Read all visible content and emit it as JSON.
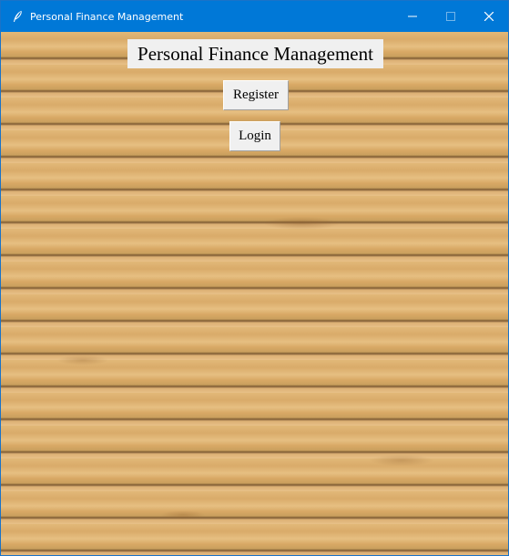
{
  "window": {
    "title": "Personal Finance Management",
    "icon": "feather-icon",
    "controls": [
      "minimize-icon",
      "maximize-icon",
      "close-icon"
    ]
  },
  "main": {
    "heading": "Personal Finance Management",
    "register_label": "Register",
    "login_label": "Login"
  },
  "colors": {
    "titlebar": "#0078d7",
    "widget_bg": "#f0f0f0",
    "wood": "#d6a96b"
  }
}
